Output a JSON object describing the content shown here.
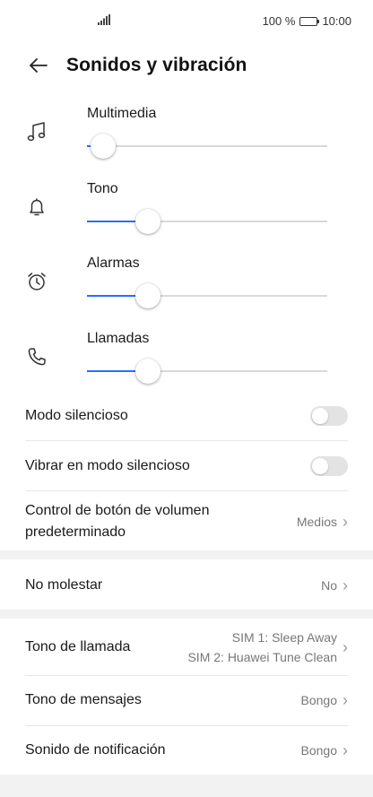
{
  "status_bar": {
    "battery_percent": "100 %",
    "time": "10:00"
  },
  "header": {
    "title": "Sonidos y vibración"
  },
  "volumes": [
    {
      "label": "Multimedia",
      "icon": "music-note-icon",
      "level": 0.02
    },
    {
      "label": "Tono",
      "icon": "bell-icon",
      "level": 0.2
    },
    {
      "label": "Alarmas",
      "icon": "alarm-clock-icon",
      "level": 0.2
    },
    {
      "label": "Llamadas",
      "icon": "phone-icon",
      "level": 0.2
    }
  ],
  "settings": {
    "silent_mode": {
      "label": "Modo silencioso",
      "on": false
    },
    "vibrate_silent": {
      "label": "Vibrar en modo silencioso",
      "on": false
    },
    "volume_button": {
      "label_line1": "Control de botón de volumen",
      "label_line2": "predeterminado",
      "value": "Medios"
    },
    "dnd": {
      "label": "No molestar",
      "value": "No"
    },
    "ringtone": {
      "label": "Tono de llamada",
      "sim1": "SIM 1: Sleep Away",
      "sim2": "SIM 2: Huawei Tune Clean"
    },
    "message_tone": {
      "label": "Tono de mensajes",
      "value": "Bongo"
    },
    "notification_sound": {
      "label": "Sonido de notificación",
      "value": "Bongo"
    }
  },
  "colors": {
    "accent": "#256fff",
    "track": "#d9d9d9",
    "background": "#ffffff"
  }
}
